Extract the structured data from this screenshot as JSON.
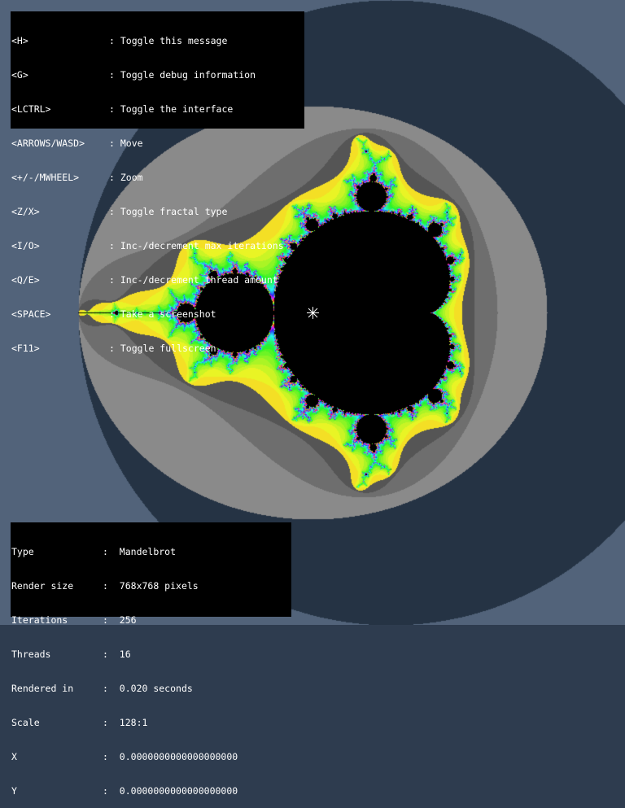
{
  "help": [
    {
      "key": "<H>",
      "desc": ": Toggle this message"
    },
    {
      "key": "<G>",
      "desc": ": Toggle debug information"
    },
    {
      "key": "<LCTRL>",
      "desc": ": Toggle the interface"
    },
    {
      "key": "<ARROWS/WASD>",
      "desc": ": Move"
    },
    {
      "key": "<+/-/MWHEEL>",
      "desc": ": Zoom"
    },
    {
      "key": "<Z/X>",
      "desc": ": Toggle fractal type"
    },
    {
      "key": "<I/O>",
      "desc": ": Inc-/decrement max iterations"
    },
    {
      "key": "<Q/E>",
      "desc": ": Inc-/decrement thread amount"
    },
    {
      "key": "<SPACE>",
      "desc": ": Take a screenshot"
    },
    {
      "key": "<F11>",
      "desc": ": Toggle fullscreen"
    }
  ],
  "info": [
    {
      "label": "Type",
      "sep": ":",
      "value": "Mandelbrot"
    },
    {
      "label": "Render size",
      "sep": ":",
      "value": "768x768 pixels"
    },
    {
      "label": "Iterations",
      "sep": ":",
      "value": "256"
    },
    {
      "label": "Threads",
      "sep": ":",
      "value": "16"
    },
    {
      "label": "Rendered in",
      "sep": ":",
      "value": "0.020 seconds"
    },
    {
      "label": "Scale",
      "sep": ":",
      "value": "128:1"
    },
    {
      "label": "X",
      "sep": ":",
      "value": "0.0000000000000000000"
    },
    {
      "label": "Y",
      "sep": ":",
      "value": "0.0000000000000000000"
    }
  ],
  "fractal": {
    "type": "mandelbrot",
    "scale": 128,
    "center_x": 0,
    "center_y": 0,
    "max_iterations": 256,
    "colors": {
      "background": "#2e3c4f",
      "band1": "#52637a",
      "band2": "#253344",
      "band3": "#8a8a8a",
      "band4": "#6e6e6e",
      "band5": "#555555",
      "set": "#000000"
    }
  }
}
